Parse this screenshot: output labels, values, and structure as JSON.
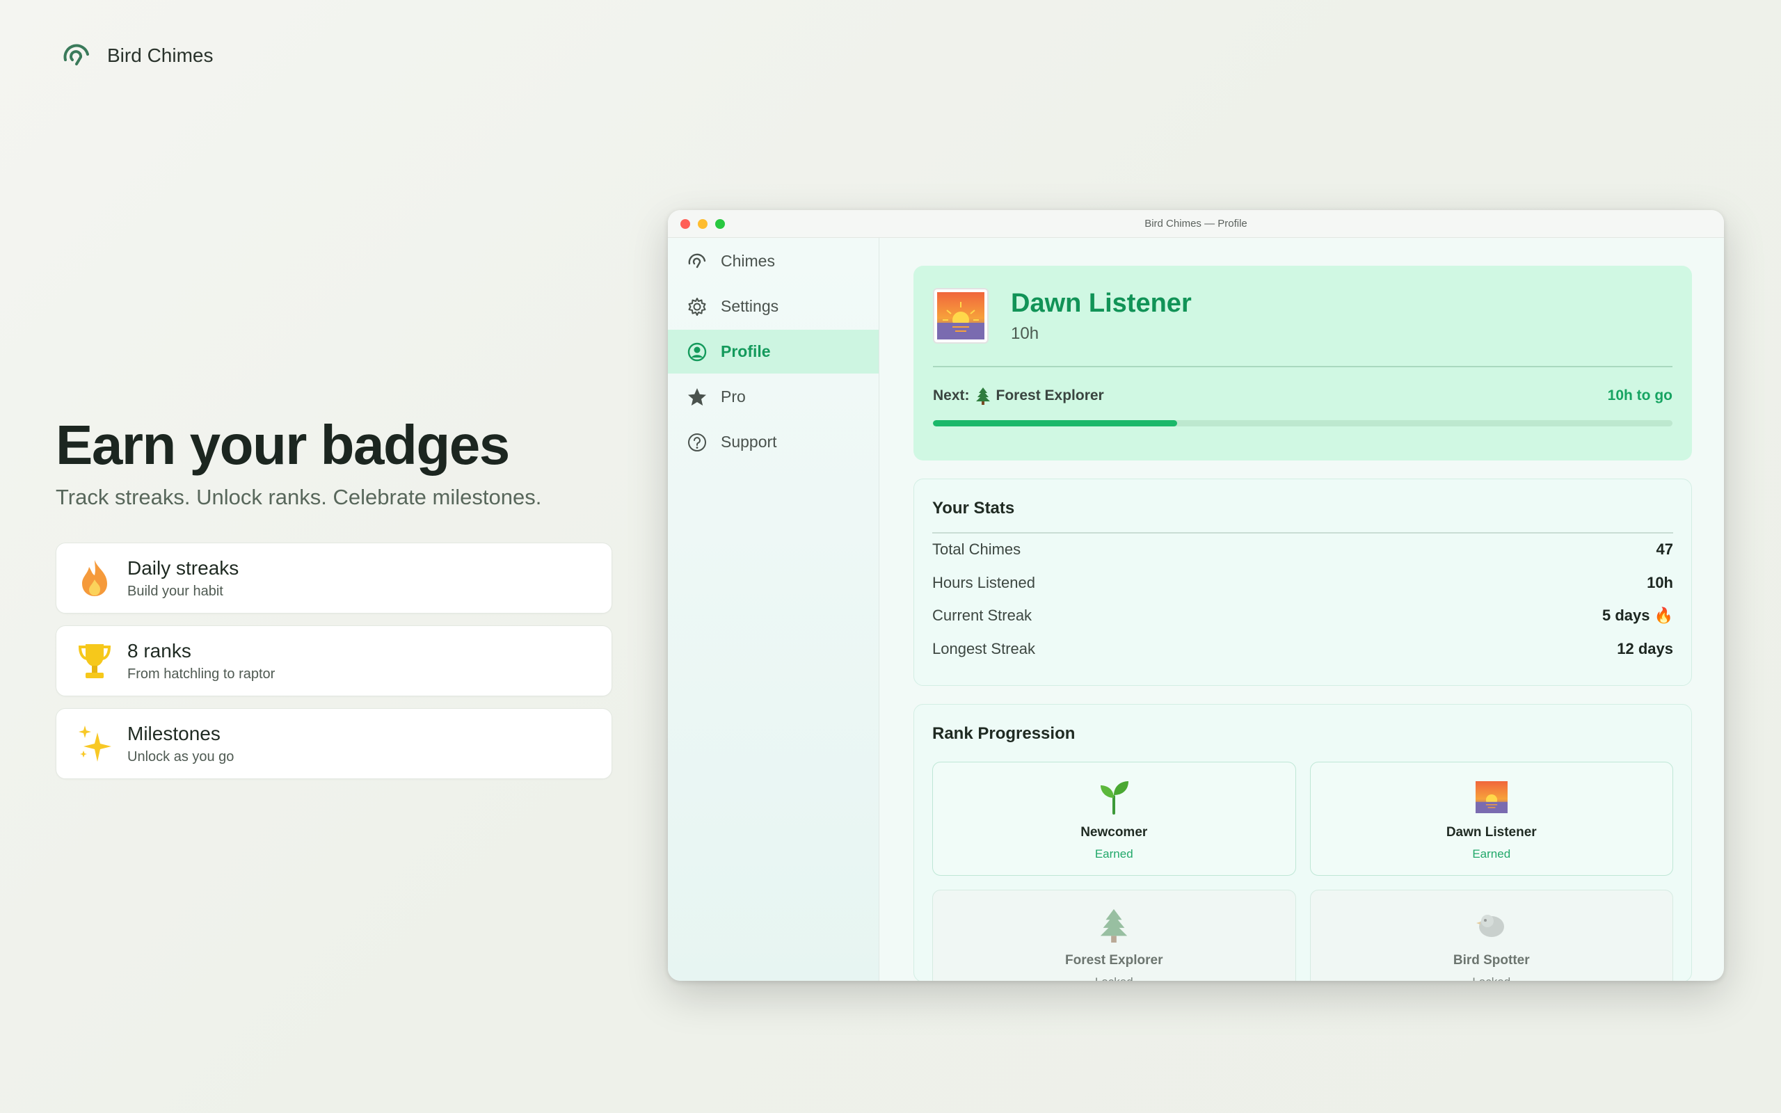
{
  "brand": {
    "name": "Bird Chimes"
  },
  "hero": {
    "title": "Earn your badges",
    "subtitle": "Track streaks. Unlock ranks. Celebrate milestones."
  },
  "features": [
    {
      "title": "Daily streaks",
      "subtitle": "Build your habit",
      "icon": "flame-icon"
    },
    {
      "title": "8 ranks",
      "subtitle": "From hatchling to raptor",
      "icon": "trophy-icon"
    },
    {
      "title": "Milestones",
      "subtitle": "Unlock as you go",
      "icon": "sparkles-icon"
    }
  ],
  "window": {
    "title": "Bird Chimes — Profile"
  },
  "sidebar": {
    "items": [
      {
        "label": "Chimes",
        "icon": "chime-icon"
      },
      {
        "label": "Settings",
        "icon": "gear-icon"
      },
      {
        "label": "Profile",
        "icon": "person-circle-icon",
        "active": true
      },
      {
        "label": "Pro",
        "icon": "star-icon"
      },
      {
        "label": "Support",
        "icon": "help-icon"
      }
    ]
  },
  "rank": {
    "name": "Dawn Listener",
    "hours": "10h",
    "next_prefix": "Next:",
    "next_name": "Forest Explorer",
    "to_go": "10h to go",
    "progress": 0.33
  },
  "stats": {
    "title": "Your Stats",
    "rows": [
      {
        "label": "Total Chimes",
        "value": "47"
      },
      {
        "label": "Hours Listened",
        "value": "10h"
      },
      {
        "label": "Current Streak",
        "value": "5 days 🔥"
      },
      {
        "label": "Longest Streak",
        "value": "12 days"
      }
    ]
  },
  "ranks": {
    "title": "Rank Progression",
    "tiles": [
      {
        "name": "Newcomer",
        "status": "Earned"
      },
      {
        "name": "Dawn Listener",
        "status": "Earned"
      },
      {
        "name": "Forest Explorer",
        "status": "Locked"
      },
      {
        "name": "Bird Spotter",
        "status": "Locked"
      }
    ]
  },
  "colors": {
    "accent": "#149a5c",
    "progress": "#1bb86a",
    "rank_bg": "#d0f8e3"
  }
}
